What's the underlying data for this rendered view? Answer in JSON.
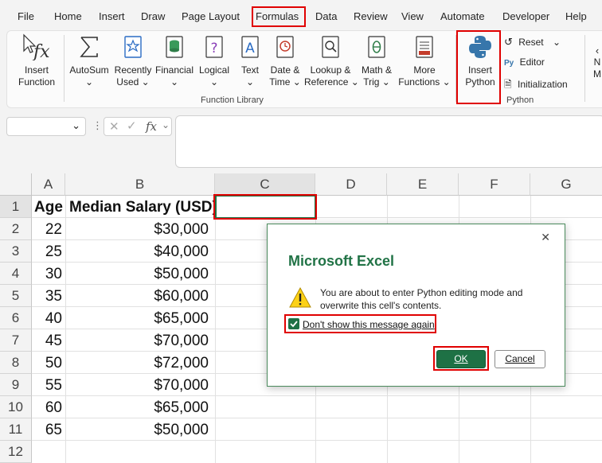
{
  "menu": [
    "File",
    "Home",
    "Insert",
    "Draw",
    "Page Layout",
    "Formulas",
    "Data",
    "Review",
    "View",
    "Automate",
    "Developer",
    "Help"
  ],
  "ribbon": {
    "insert_function": [
      "Insert",
      "Function"
    ],
    "autosum": "AutoSum",
    "recently_used": [
      "Recently",
      "Used"
    ],
    "financial": "Financial",
    "logical": "Logical",
    "text": "Text",
    "date_time": [
      "Date &",
      "Time"
    ],
    "lookup": [
      "Lookup &",
      "Reference"
    ],
    "math": [
      "Math &",
      "Trig"
    ],
    "more": [
      "More",
      "Functions"
    ],
    "function_library": "Function Library",
    "insert_python": [
      "Insert",
      "Python"
    ],
    "reset": "Reset",
    "editor": "Editor",
    "initialization": "Initialization",
    "python_group": "Python",
    "cut_off": [
      "N",
      "M"
    ]
  },
  "formula_bar": {
    "fx": "fx",
    "name_box": "",
    "formula": ""
  },
  "columns": [
    "A",
    "B",
    "C",
    "D",
    "E",
    "F",
    "G"
  ],
  "rows": [
    "1",
    "2",
    "3",
    "4",
    "5",
    "6",
    "7",
    "8",
    "9",
    "10",
    "11",
    "12"
  ],
  "sheet": {
    "header_age": "Age",
    "header_salary": "Median Salary (USD)",
    "data": [
      {
        "age": "22",
        "salary": "$30,000"
      },
      {
        "age": "25",
        "salary": "$40,000"
      },
      {
        "age": "30",
        "salary": "$50,000"
      },
      {
        "age": "35",
        "salary": "$60,000"
      },
      {
        "age": "40",
        "salary": "$65,000"
      },
      {
        "age": "45",
        "salary": "$70,000"
      },
      {
        "age": "50",
        "salary": "$72,000"
      },
      {
        "age": "55",
        "salary": "$70,000"
      },
      {
        "age": "60",
        "salary": "$65,000"
      },
      {
        "age": "65",
        "salary": "$50,000"
      }
    ]
  },
  "dialog": {
    "title": "Microsoft Excel",
    "message": "You are about to enter Python editing mode and overwrite this cell's contents.",
    "checkbox_label": "Don't show this message again",
    "checkbox_checked": true,
    "ok": "OK",
    "cancel": "Cancel",
    "close": "✕"
  },
  "colors": {
    "excel_green": "#217346",
    "highlight_red": "#e00000",
    "ok_button": "#1e7145"
  }
}
